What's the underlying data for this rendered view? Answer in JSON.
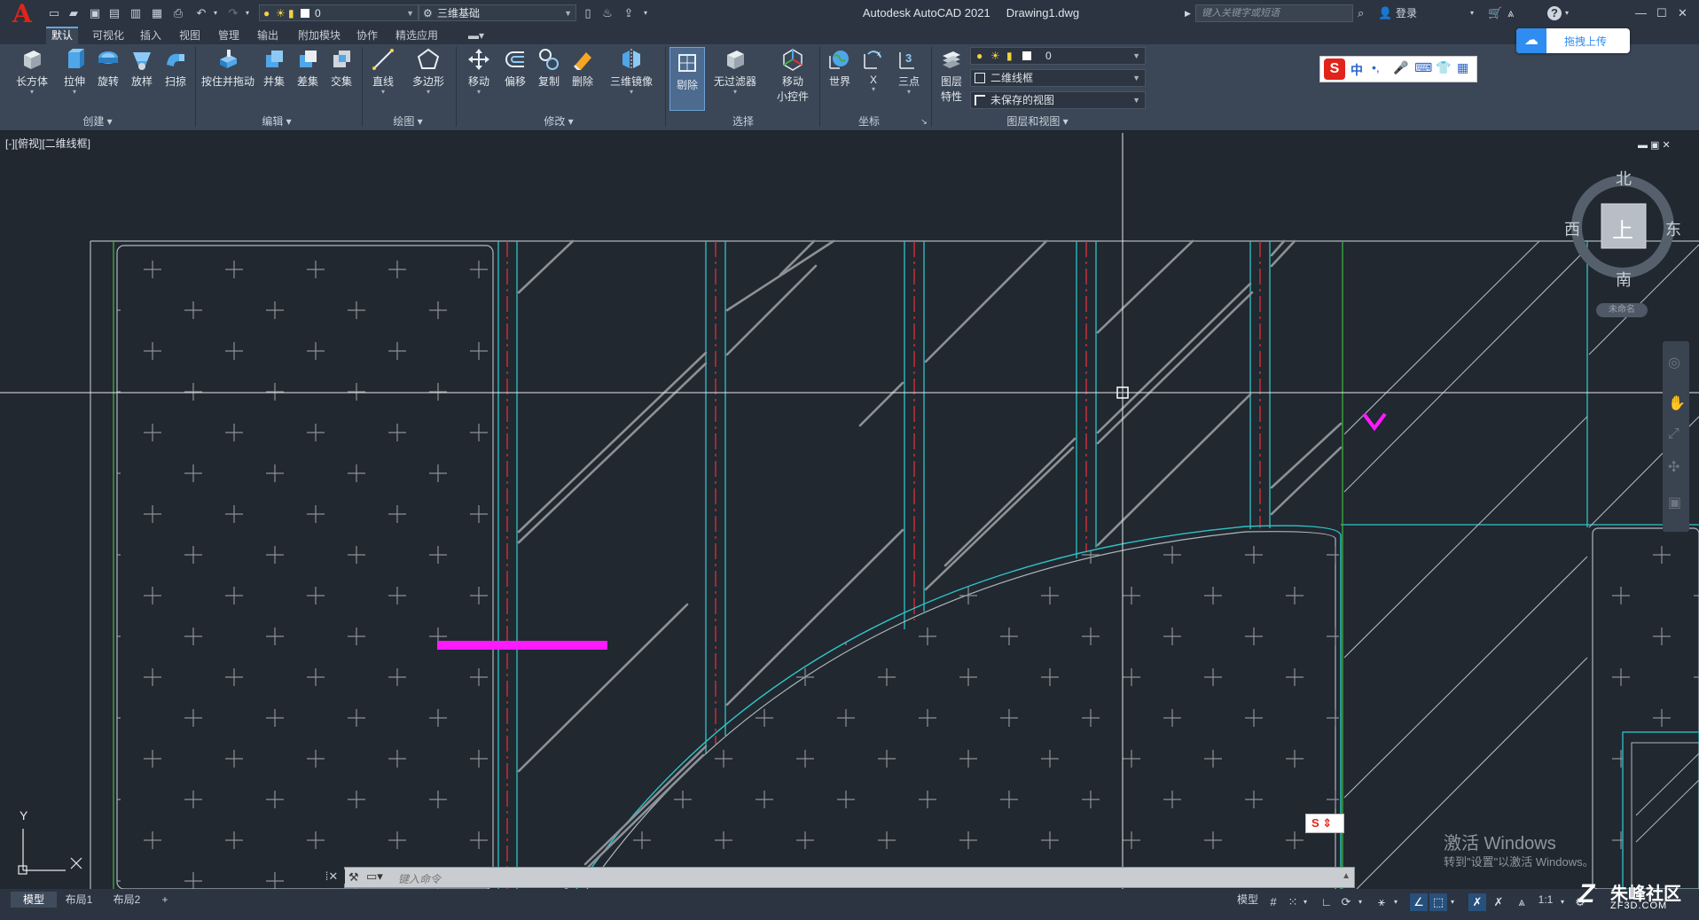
{
  "titlebar": {
    "app_logo": "A",
    "workspace_layer_value": "0",
    "workspace_name": "三维基础",
    "app_title": "Autodesk AutoCAD 2021",
    "file_name": "Drawing1.dwg",
    "search_placeholder": "键入关键字或短语",
    "login_label": "登录",
    "help_label": "?"
  },
  "menu_tabs": [
    "默认",
    "可视化",
    "插入",
    "视图",
    "管理",
    "输出",
    "附加模块",
    "协作",
    "精选应用"
  ],
  "active_tab": "默认",
  "ribbon": {
    "create": {
      "label": "创建",
      "buttons": [
        "长方体",
        "拉伸",
        "旋转",
        "放样",
        "扫掠"
      ]
    },
    "edit": {
      "label": "编辑",
      "buttons": [
        "按住并拖动",
        "并集",
        "差集",
        "交集"
      ]
    },
    "draw": {
      "label": "绘图",
      "buttons": [
        "直线",
        "多边形"
      ]
    },
    "modify": {
      "label": "修改",
      "buttons": [
        "移动",
        "偏移",
        "复制",
        "删除",
        "三维镜像"
      ]
    },
    "select": {
      "label": "选择",
      "buttons": [
        "剔除",
        "无过滤器",
        "移动",
        "小控件"
      ]
    },
    "coords": {
      "label": "坐标",
      "buttons": [
        "世界",
        "X",
        "三点"
      ]
    },
    "layers": {
      "label": "图层和视图",
      "properties_label_1": "图层",
      "properties_label_2": "特性",
      "layer_value": "0",
      "visual_style": "二维线框",
      "named_view": "未保存的视图"
    }
  },
  "viewport": {
    "label": "[-][俯视][二维线框]",
    "viewcube": {
      "north": "北",
      "south": "南",
      "east": "东",
      "west": "西",
      "top": "上",
      "wcs": "未命名"
    },
    "ucs": {
      "y": "Y",
      "x": "X"
    }
  },
  "command_line": {
    "placeholder": "键入命令"
  },
  "status": {
    "layout_tabs": [
      "模型",
      "布局1",
      "布局2"
    ],
    "add_tab": "+",
    "model_label": "模型",
    "scale": "1:1"
  },
  "overlays": {
    "upload_button": "拖拽上传",
    "ime_label": "中",
    "watermark_line1": "激活 Windows",
    "watermark_line2": "转到\"设置\"以激活 Windows。",
    "brand_name": "朱峰社区",
    "brand_url": "ZF3D.COM"
  },
  "colors": {
    "background": "#212830",
    "cyan_lines": "#2fc4c8",
    "red_centerline": "#e0303a",
    "green_line": "#3fae3f",
    "magenta_marker": "#ff19ff",
    "hatch_lines": "#8c9196",
    "accent": "#6aa3d8"
  }
}
